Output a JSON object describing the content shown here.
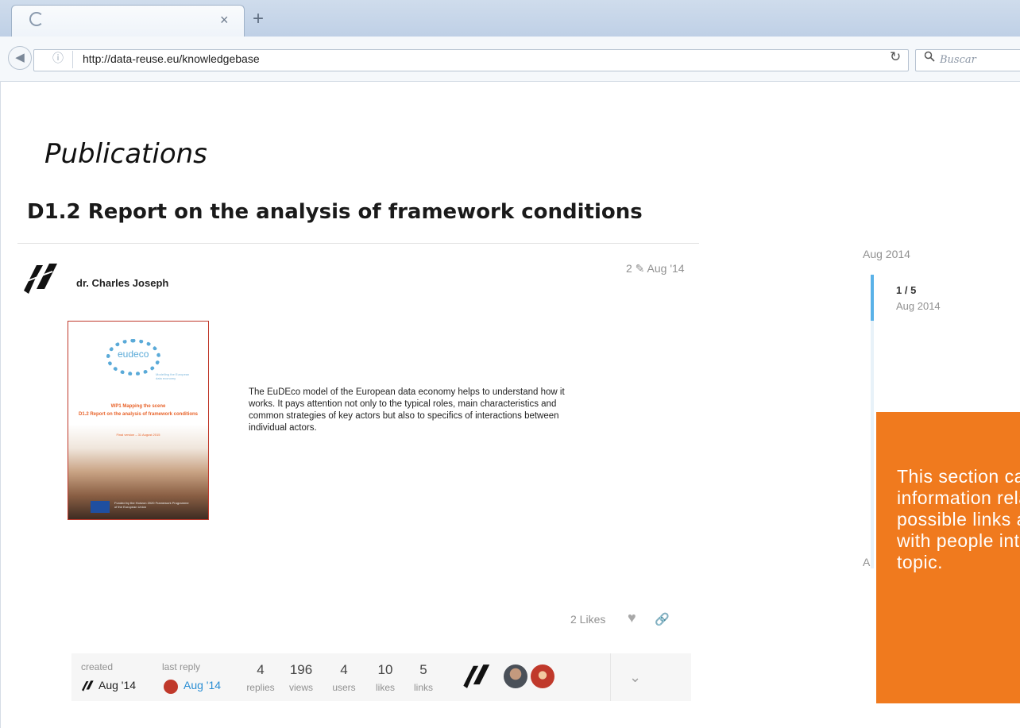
{
  "browser": {
    "tab_close": "×",
    "new_tab": "+",
    "url": "http://data-reuse.eu/knowledgebase",
    "search_placeholder": "Buscar"
  },
  "page": {
    "section_title": "Publications",
    "topic_title": "D1.2 Report on the analysis of framework conditions"
  },
  "post": {
    "author": "dr. Charles Joseph",
    "meta": "2 ✎ Aug '14",
    "excerpt": "The EuDEco model of the European data economy helps to understand how it works. It pays attention not only to the typical roles, main characteristics and common strategies of key actors but also to specifics of interactions between individual actors.",
    "cover": {
      "logo_text": "eudeco",
      "logo_sub": "Modelling the European data economy",
      "line1": "WP1 Mapping the scene",
      "line2": "D1.2 Report on the analysis of framework conditions",
      "line3": "Final version – 31 August 2015",
      "funding": "Funded by the Horizon 2020 Framework Programme of the European Union"
    },
    "likes": "2 Likes"
  },
  "topic_map": {
    "created_label": "created",
    "created_date": "Aug '14",
    "last_reply_label": "last reply",
    "last_reply_date": "Aug '14",
    "stats": [
      {
        "number": "4",
        "label": "replies"
      },
      {
        "number": "196",
        "label": "views"
      },
      {
        "number": "4",
        "label": "users"
      },
      {
        "number": "10",
        "label": "likes"
      },
      {
        "number": "5",
        "label": "links"
      }
    ]
  },
  "timeline": {
    "top_date": "Aug 2014",
    "position": "1 / 5",
    "position_date": "Aug 2014",
    "bottom_date": "A"
  },
  "callout": {
    "text": "This section can be drafted with information related to the sector, possible links and connections with people interested in the topic."
  },
  "colors": {
    "callout_bg": "#f07a1e",
    "timeline_accent": "#5ab2e8",
    "link_blue": "#2a8ed4"
  }
}
